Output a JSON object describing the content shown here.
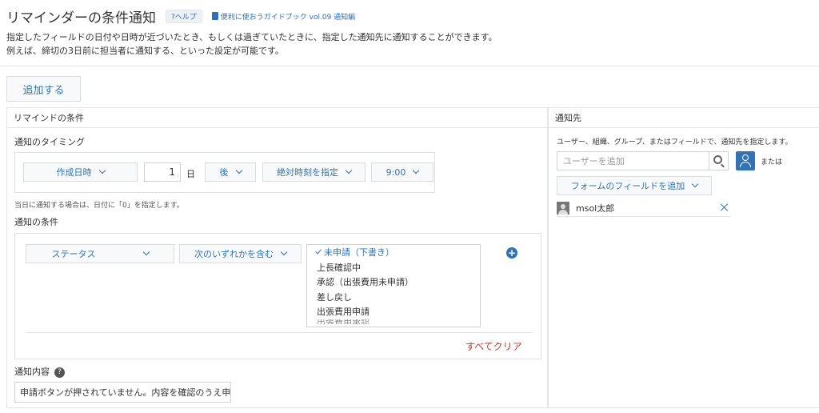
{
  "header": {
    "title": "リマインダーの条件通知",
    "help_label": "?ヘルプ",
    "guide_label": "便利に使おうガイドブック vol.09 通知編",
    "desc_line1": "指定したフィールドの日付や日時が近づいたとき、もしくは過ぎていたときに、指定した通知先に通知することができます。",
    "desc_line2": "例えば、締切の3日前に担当者に通知する、といった設定が可能です。"
  },
  "toolbar": {
    "add_label": "追加する"
  },
  "conditions_panel": {
    "title": "リマインドの条件",
    "timing": {
      "label": "通知のタイミング",
      "field": "作成日時",
      "days_value": "1",
      "days_unit": "日",
      "direction": "後",
      "time_mode": "絶対時刻を指定",
      "time": "9:00",
      "note": "当日に通知する場合は、日付に「0」を指定します。"
    },
    "condition": {
      "label": "通知の条件",
      "field": "ステータス",
      "operator": "次のいずれかを含む",
      "options": [
        {
          "label": "未申請（下書き）",
          "selected": true
        },
        {
          "label": "上長確認中",
          "selected": false
        },
        {
          "label": "承認（出張費用未申請）",
          "selected": false
        },
        {
          "label": "差し戻し",
          "selected": false
        },
        {
          "label": "出張費用申請",
          "selected": false
        },
        {
          "label": "出張費用承認",
          "selected": false
        }
      ],
      "clear_label": "すべてクリア"
    },
    "content": {
      "label": "通知内容",
      "value": "申請ボタンが押されていません。内容を確認のうえ申"
    }
  },
  "recipients_panel": {
    "title": "通知先",
    "desc": "ユーザー、組織、グループ、またはフィールドで、通知先を指定します。",
    "user_placeholder": "ユーザーを追加",
    "or_label": "または",
    "field_add_label": "フォームのフィールドを追加",
    "recipients": [
      {
        "name": "msol太郎"
      }
    ]
  },
  "colors": {
    "accent": "#3173b4",
    "danger": "#c0392b"
  }
}
